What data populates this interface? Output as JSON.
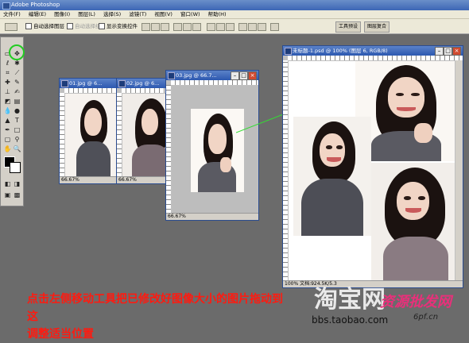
{
  "app": {
    "title": "Adobe Photoshop"
  },
  "menu": [
    "文件(F)",
    "编辑(E)",
    "图像(I)",
    "图层(L)",
    "选择(S)",
    "滤镜(T)",
    "视图(V)",
    "窗口(W)",
    "帮助(H)"
  ],
  "options": {
    "auto_select_layer": "自动选择图层",
    "auto_select_group": "自动选择组",
    "show_transform": "显示变换控件"
  },
  "palette_tabs": [
    "工具预设",
    "图层复合"
  ],
  "documents": [
    {
      "title": "01.jpg @ 6...",
      "zoom": "66.67%"
    },
    {
      "title": "02.jpg @ 6...",
      "zoom": "66.67%"
    },
    {
      "title": "03.jpg @ 66.7...",
      "zoom": "66.67%"
    },
    {
      "title": "未标题-1.psd @ 100% (图层 6, RGB/8)",
      "zoom": "100%",
      "status_extra": "文档:924.5K/5.3"
    }
  ],
  "caption": {
    "line1": "点击左侧移动工具把已修改好图像大小的图片拖动到这",
    "line2": "调整适当位置"
  },
  "watermarks": {
    "taobao": "淘宝网",
    "site": "bbs.taobao.com",
    "brand": "资源批发网",
    "brand_url": "6pf.cn"
  },
  "colors": {
    "caption": "#ff1a10",
    "highlight_ring": "#22cc22",
    "arrow": "#33dd33"
  }
}
